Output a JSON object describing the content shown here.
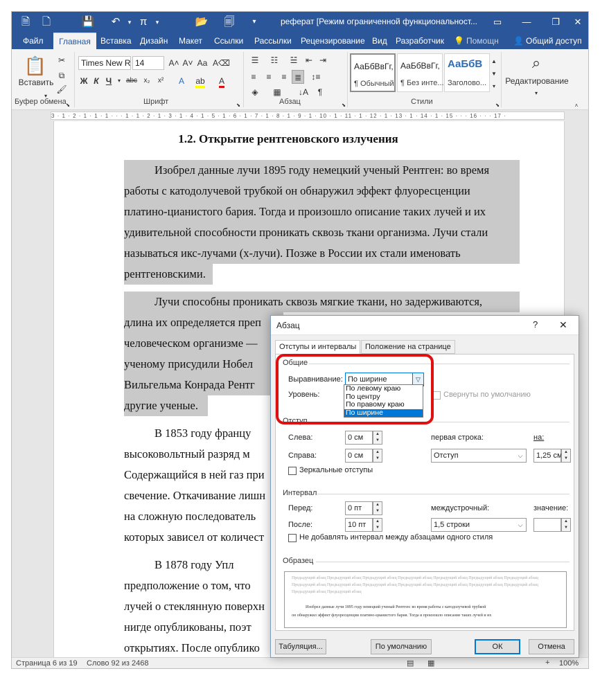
{
  "titlebar": {
    "doc_title": "реферат [Режим ограниченной функциональност...",
    "quick_access": {
      "undo_caret": "▾",
      "pi": "π"
    },
    "window_buttons": {
      "minimize": "—",
      "restore": "❐",
      "close": "✕"
    }
  },
  "ribbon_tabs": [
    {
      "label": "Файл"
    },
    {
      "label": "Главная"
    },
    {
      "label": "Вставка"
    },
    {
      "label": "Дизайн"
    },
    {
      "label": "Макет"
    },
    {
      "label": "Ссылки"
    },
    {
      "label": "Рассылки"
    },
    {
      "label": "Рецензирование"
    },
    {
      "label": "Вид"
    },
    {
      "label": "Разработчик"
    }
  ],
  "help": {
    "label": "Помощн"
  },
  "share": {
    "label": "Общий доступ"
  },
  "ribbon": {
    "paste_label": "Вставить",
    "font_name": "Times New R",
    "font_size": "14",
    "bold": "Ж",
    "italic": "К",
    "underline": "Ч",
    "groups": {
      "clipboard": "Буфер обмена",
      "font": "Шрифт",
      "paragraph": "Абзац",
      "styles": "Стили"
    },
    "styles": [
      {
        "preview": "АаБбВвГг,",
        "name": "¶ Обычный"
      },
      {
        "preview": "АаБбВвГг,",
        "name": "¶ Без инте..."
      },
      {
        "preview": "АаБбВ",
        "name": "Заголово..."
      }
    ],
    "editing_label": "Редактирование"
  },
  "ruler_text": "3 · 1 · 2 · 1 · 1 · 1 · · · 1 · 1 · 2 · 1 · 3 · 1 · 4 · 1 · 5 · 1 · 6 · 1 · 7 · 1 · 8 · 1 · 9 · 1 · 10 · 1 · 11 · 1 · 12 · 1 · 13 · 1 · 14 · 1 · 15 · · · 16 · · · 17 ·",
  "document": {
    "heading": "1.2. Открытие рентгеновского излучения",
    "p1": [
      "Изобрел данные лучи 1895 году немецкий ученый Рентген: во время",
      "работы с катодолучевой трубкой он обнаружил эффект флуоресценции",
      "платино-цианистого бария. Тогда и произошло описание таких лучей и их",
      "удивительной способности проникать сквозь ткани организма. Лучи стали",
      "называться икс-лучами (х-лучи). Позже в России их стали именовать",
      "рентгеновскими."
    ],
    "p2": [
      "Лучи способны проникать сквозь мягкие ткани, но задерживаются,",
      "длина их определяется преп",
      "человеческом организме —",
      "ученому присудили Нобел",
      "Вильгельма Конрада Рентг",
      "другие ученые."
    ],
    "p3": [
      "В 1853 году францу",
      "высоковольтный разряд м",
      "Содержащийся в ней газ при",
      "свечение. Откачивание лишн",
      "на сложную последователь",
      "которых зависел от количест"
    ],
    "p4": [
      "В 1878 году Упл",
      "предположение о том, что",
      "лучей о стеклянную поверхн",
      "нигде опубликованы, поэт",
      "открытиях. После опублико"
    ]
  },
  "status": {
    "page": "Страница 6 из 19",
    "words": "Слово 92 из 2468",
    "zoom": "100%"
  },
  "dialog": {
    "title": "Абзац",
    "help": "?",
    "close": "✕",
    "tabs": [
      {
        "label": "Отступы и интервалы"
      },
      {
        "label": "Положение на странице"
      }
    ],
    "general": {
      "section": "Общие",
      "alignment_label": "Выравнивание:",
      "alignment_value": "По ширине",
      "level_label": "Уровень:",
      "collapsed_label": "Свернуты по умолчанию",
      "alignment_options": [
        "По левому краю",
        "По центру",
        "По правому краю",
        "По ширине"
      ],
      "selected_option": "По ширине"
    },
    "indent": {
      "section": "Отступ",
      "left_label": "Слева:",
      "left_value": "0 см",
      "right_label": "Справа:",
      "right_value": "0 см",
      "first_line_label": "первая строка:",
      "first_line_value": "Отступ",
      "by_label": "на:",
      "by_value": "1,25 см",
      "mirror_label": "Зеркальные отступы"
    },
    "spacing": {
      "section": "Интервал",
      "before_label": "Перед:",
      "before_value": "0 пт",
      "after_label": "После:",
      "after_value": "10 пт",
      "line_label": "междустрочный:",
      "line_value": "1,5 строки",
      "value_label": "значение:",
      "value_value": "",
      "no_space_label": "Не добавлять интервал между абзацами одного стиля"
    },
    "sample": {
      "section": "Образец",
      "prev_line": "Предыдущий абзац Предыдущий абзац Предыдущий абзац Предыдущий абзац Предыдущий абзац Предыдущий абзац Предыдущий абзац",
      "prev_line2": "Предыдущий абзац Предыдущий абзац Предыдущий абзац Предыдущий абзац Предыдущий абзац Предыдущий абзац Предыдущий абзац",
      "prev_line3": "Предыдущий абзац Предыдущий абзац",
      "text1": "Изобрел данные лучи 1895 году немецкий ученый Рентген: во время работы с катодолучевой трубкой",
      "text2": "он обнаружил эффект флуоресценции платино-цианистого бария. Тогда и произошло описание таких лучей и их"
    },
    "buttons": {
      "tabs": "Табуляция...",
      "default": "По умолчанию",
      "ok": "ОК",
      "cancel": "Отмена"
    }
  },
  "colors": {
    "accent": "#2b579a",
    "highlight": "#e01010",
    "selection": "#0078d7"
  }
}
